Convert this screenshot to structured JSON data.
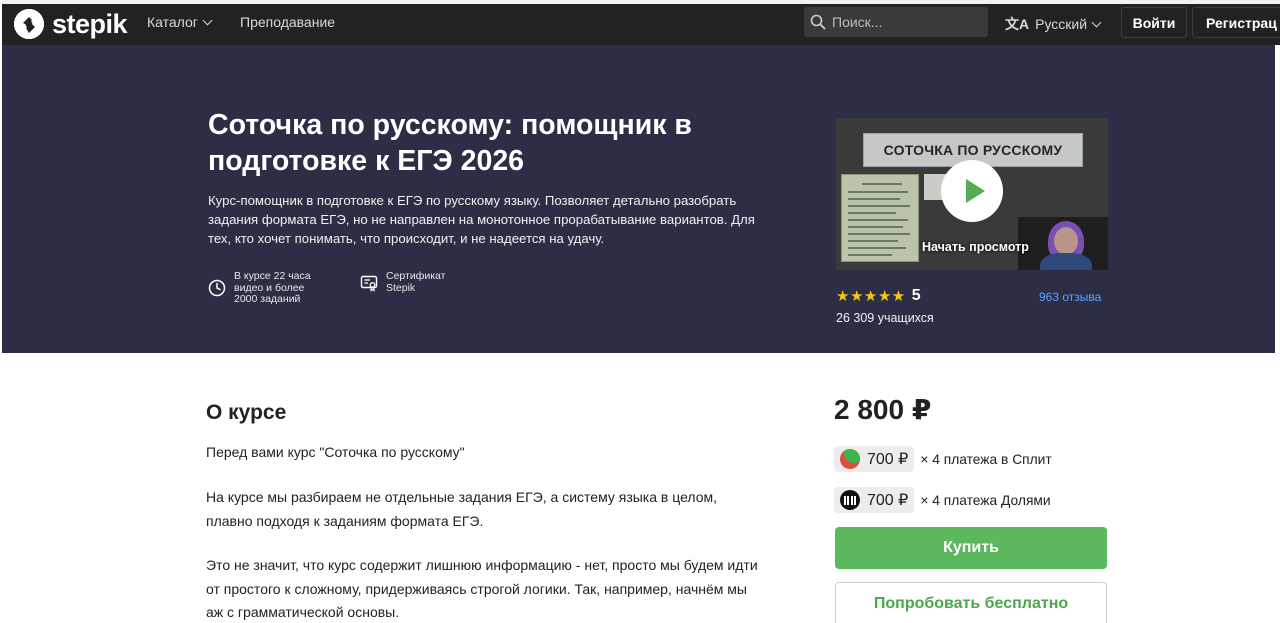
{
  "header": {
    "logo_text": "stepik",
    "nav": [
      {
        "label": "Каталог",
        "has_dropdown": true
      },
      {
        "label": "Преподавание",
        "has_dropdown": false
      }
    ],
    "search": {
      "placeholder": "Поиск..."
    },
    "language": "Русский",
    "login_label": "Войти",
    "register_label": "Регистрац"
  },
  "hero": {
    "title": "Соточка по русскому: помощник в подготовке к ЕГЭ 2026",
    "description": "Курс-помощник в подготовке к ЕГЭ по русскому языку. Позволяет детально разобрать задания формата ЕГЭ, но не направлен на монотонное прорабатывание вариантов. Для тех, кто хочет понимать, что происходит, и не надеется на удачу.",
    "features": [
      {
        "icon": "clock-icon",
        "text": "В курсе 22 часа видео и более 2000 заданий"
      },
      {
        "icon": "certificate-icon",
        "text": "Сертификат Stepik"
      }
    ],
    "video": {
      "banner_text": "СОТОЧКА ПО РУССКОМУ",
      "play_label": "Начать просмотр"
    },
    "rating": {
      "stars": "★★★★★",
      "value": "5"
    },
    "reviews_label": "963 отзыва",
    "learners_label": "26 309 учащихся"
  },
  "about": {
    "title": "О курсе",
    "paragraphs": [
      "Перед вами курс \"Соточка по русскому\"",
      "На курсе мы разбираем не отдельные задания ЕГЭ, а систему языка в целом, плавно подходя к заданиям формата ЕГЭ.",
      "Это не значит, что курс содержит лишнюю информацию - нет, просто мы будем идти от простого к сложному, придерживаясь строгой логики. Так, например, начнём мы аж с грамматической основы."
    ]
  },
  "purchase": {
    "price": "2 800 ₽",
    "installments": [
      {
        "icon": "split-icon",
        "amount": "700 ₽",
        "text": "× 4 платежа в Сплит"
      },
      {
        "icon": "dolyami-icon",
        "amount": "700 ₽",
        "text": "× 4 платежа Долями"
      }
    ],
    "buy_label": "Купить",
    "try_label": "Попробовать бесплатно"
  },
  "colors": {
    "topbar": "#222222",
    "hero_bg": "#2c2e45",
    "accent_green": "#5cb85c",
    "link_blue": "#5aa2ff",
    "star_yellow": "#f5c518"
  }
}
